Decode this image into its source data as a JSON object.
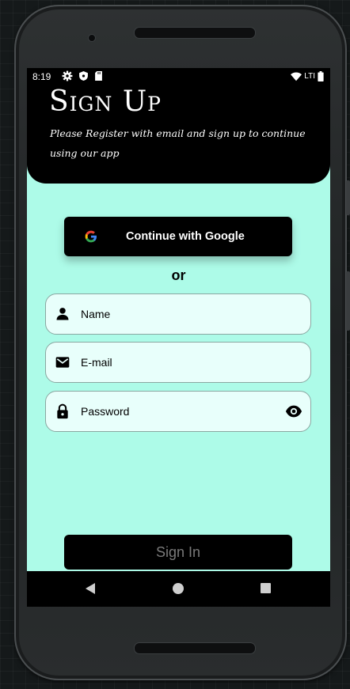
{
  "status_bar": {
    "time": "8:19",
    "network": "LTI",
    "icons": [
      "gear-icon",
      "shield-icon",
      "sd-card-icon",
      "wifi-icon",
      "battery-icon"
    ]
  },
  "header": {
    "title": "Sign Up",
    "subtitle": "Please Register with email and sign up to continue using our app"
  },
  "google_button": {
    "label": "Continue with Google",
    "icon": "google-icon"
  },
  "divider": {
    "label": "or"
  },
  "fields": {
    "name": {
      "label": "Name",
      "icon": "person-icon"
    },
    "email": {
      "label": "E-mail",
      "icon": "mail-icon"
    },
    "password": {
      "label": "Password",
      "icon": "lock-icon",
      "trailing_icon": "eye-icon"
    }
  },
  "sign_in": {
    "label": "Sign In"
  },
  "nav_bar": {
    "buttons": [
      "back-icon",
      "home-icon",
      "recents-icon"
    ]
  },
  "colors": {
    "screen_background": "#adfbe8",
    "field_background": "#e8fffb",
    "button_background": "#000000",
    "sign_in_text": "#7a7a7a"
  }
}
